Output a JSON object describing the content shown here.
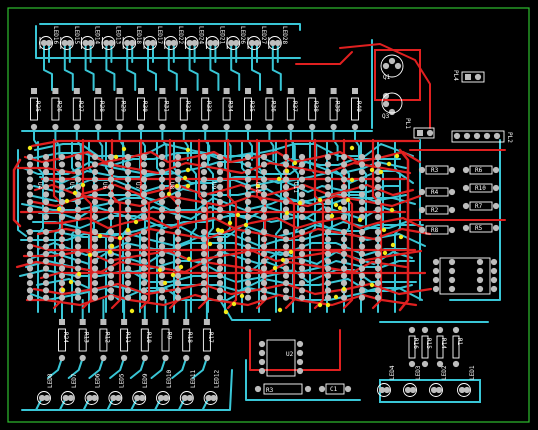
{
  "colors": {
    "background": "#000000",
    "board_outline": "#2fbf2f",
    "top_copper": "#e02020",
    "bottom_copper": "#39c6d6",
    "via": "#f2ea18",
    "pad": "#bdbdbd",
    "silkscreen": "#ffffff"
  },
  "pcb": {
    "leds_top": [
      "LED16",
      "LED15",
      "LED14",
      "LED13",
      "LED18",
      "LED17",
      "LED22",
      "LED24",
      "LED21",
      "LED26",
      "LED27",
      "LED28"
    ],
    "resistors_top": [
      "R25",
      "R26",
      "R27",
      "R28",
      "R29",
      "R30",
      "R31",
      "R32",
      "R33",
      "R34",
      "R35",
      "R36",
      "R37",
      "R38",
      "R39",
      "R40"
    ],
    "resistors_bottom": [
      "R24",
      "R13",
      "R12",
      "R11",
      "R10",
      "R9",
      "R18",
      "R17"
    ],
    "leds_bottom": [
      "LED8",
      "LED7",
      "LED6",
      "LED5",
      "LED9",
      "LED10",
      "LED11",
      "LED12"
    ],
    "leds_br": [
      "LED4",
      "LED3",
      "LED2",
      "LED1"
    ],
    "resistors_br": [
      "R16",
      "R15",
      "R14",
      "R1"
    ],
    "right_resistors": [
      "R3",
      "R4",
      "R2",
      "R8",
      "R6",
      "R10",
      "R7",
      "R5"
    ],
    "center_labels": [
      "U1",
      "U2",
      "C1",
      "C2",
      "C3"
    ],
    "connectors": [
      "PL1",
      "PL2",
      "PL4",
      "Q1",
      "Q3"
    ],
    "r3_label": "R3",
    "c1_label": "C1",
    "u2_label": "U2"
  }
}
